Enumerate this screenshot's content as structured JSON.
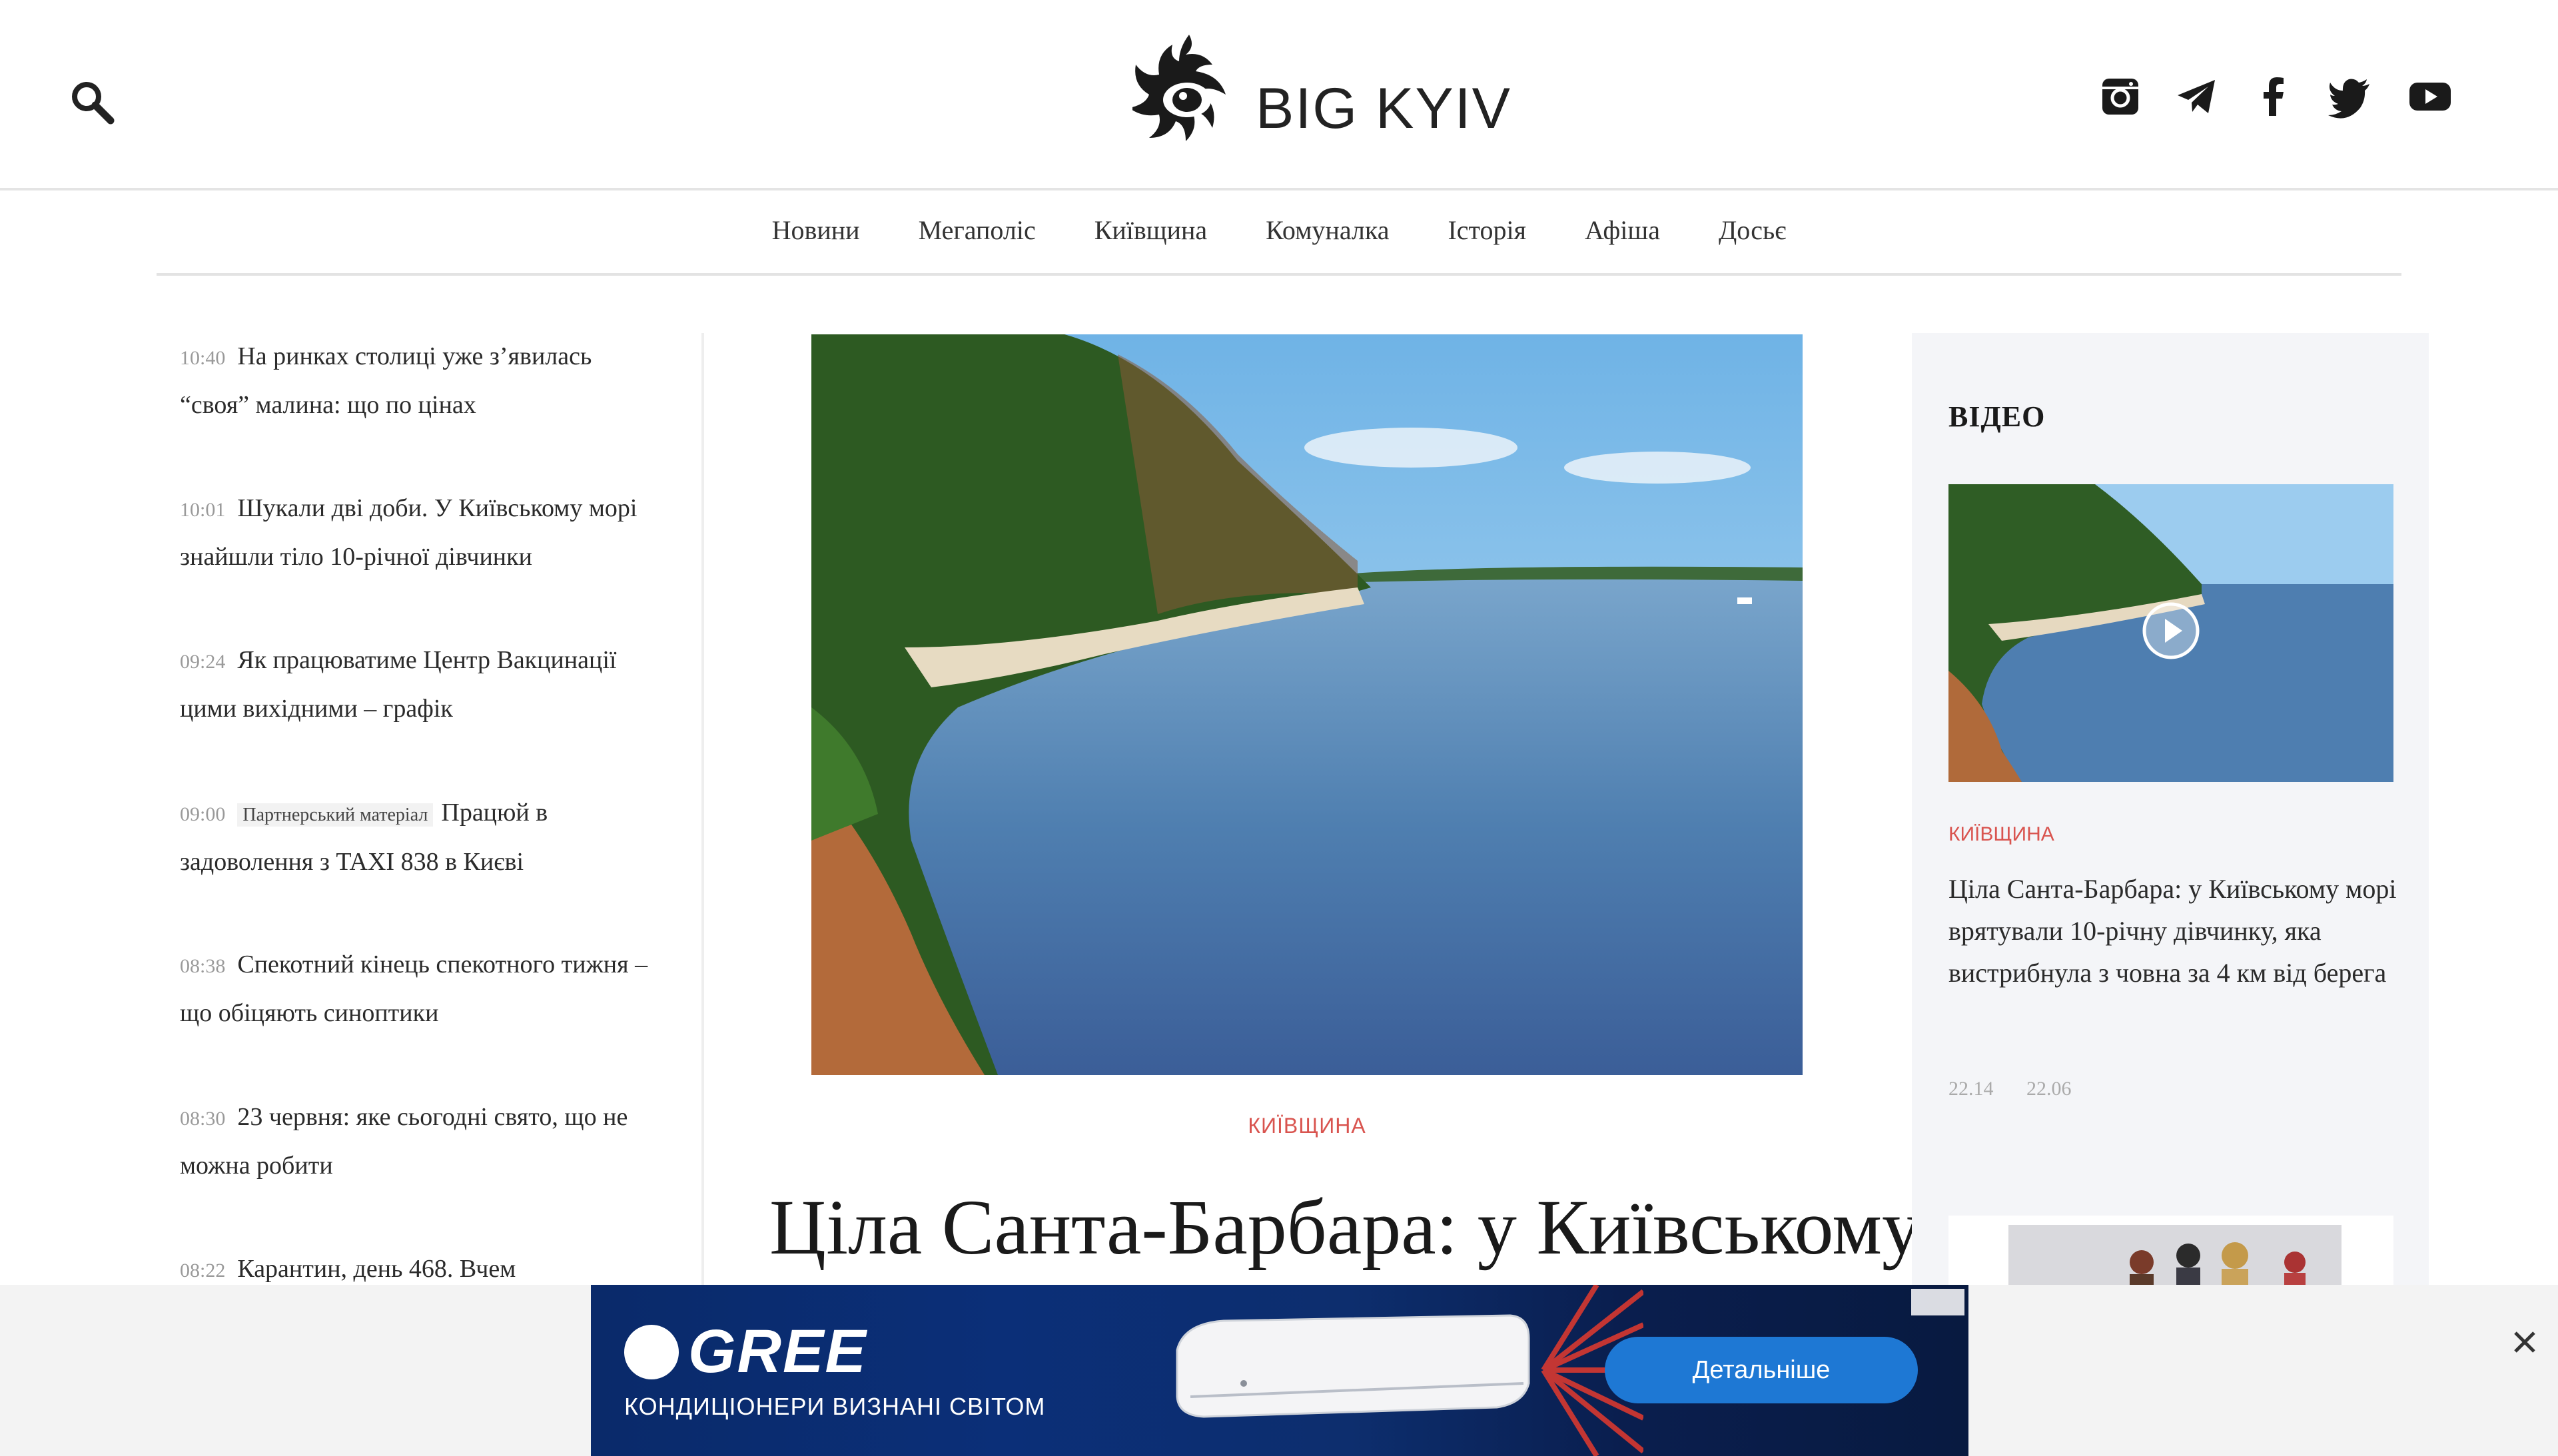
{
  "header": {
    "logo_text": "BIG KYIV",
    "search_icon": "search-icon",
    "social": [
      "instagram-icon",
      "telegram-icon",
      "facebook-icon",
      "twitter-icon",
      "youtube-icon"
    ]
  },
  "nav": {
    "items": [
      "Новини",
      "Мегаполіс",
      "Київщина",
      "Комуналка",
      "Історія",
      "Афіша",
      "Досьє"
    ]
  },
  "news": [
    {
      "time": "10:40",
      "title": "На ринках столиці уже з’явилась “своя” малина: що по цінах"
    },
    {
      "time": "10:01",
      "title": "Шукали дві доби. У Київському морі знайшли тіло 10-річної дівчинки"
    },
    {
      "time": "09:24",
      "title": "Як працюватиме Центр Вакцинації цими вихідними – графік"
    },
    {
      "time": "09:00",
      "badge": "Партнерський матеріал",
      "title": "Працюй в задоволення з TAXI 838 в Києві"
    },
    {
      "time": "08:38",
      "title": "Спекотний кінець спекотного тижня – що обіцяють синоптики"
    },
    {
      "time": "08:30",
      "title": "23 червня: яке сьогодні свято, що не можна робити"
    },
    {
      "time": "08:22",
      "title": "Карантин, день 468. Вчем"
    }
  ],
  "article": {
    "category": "КИЇВЩИНА",
    "headline": "Ціла Санта-Барбара: у Київському"
  },
  "sidebar": {
    "heading": "ВІДЕО",
    "category": "КИЇВЩИНА",
    "title": "Ціла Санта-Барбара: у Київському морі врятували 10-річну дівчинку, яка вистрибнула з човна за 4 км від берега",
    "meta": [
      "22.14",
      "22.06"
    ]
  },
  "ad": {
    "brand": "GREE",
    "tagline": "КОНДИЦІОНЕРИ ВИЗНАНІ СВІТОМ",
    "cta": "Детальніше",
    "close_icon": "close-icon"
  },
  "colors": {
    "accent": "#d9544f",
    "sidebar_bg": "#f4f5f8",
    "ad_cta": "#1e78d4"
  }
}
